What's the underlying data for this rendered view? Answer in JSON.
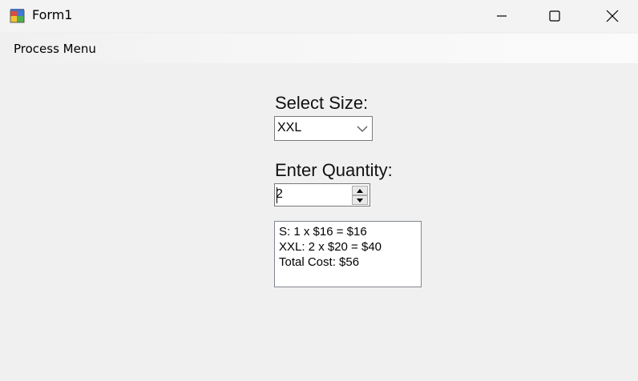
{
  "window": {
    "title": "Form1"
  },
  "menu": {
    "items": [
      {
        "label": "Process Menu"
      }
    ]
  },
  "size_section": {
    "label": "Select Size:",
    "selected": "XXL"
  },
  "quantity_section": {
    "label": "Enter Quantity:",
    "value": "2"
  },
  "summary": {
    "lines": [
      "S: 1 x $16 = $16",
      "XXL: 2 x $20 = $40",
      "Total Cost: $56"
    ]
  },
  "icons": {
    "app": "winforms-app-icon",
    "minimize": "minimize-icon",
    "maximize": "maximize-icon",
    "close": "close-icon",
    "dropdown": "chevron-down-icon",
    "spin_up": "triangle-up-icon",
    "spin_down": "triangle-down-icon"
  },
  "colors": {
    "background": "#f0f0f0",
    "titlebar": "#f3f3f3",
    "field": "#ffffff",
    "border": "#7a7a7a"
  }
}
